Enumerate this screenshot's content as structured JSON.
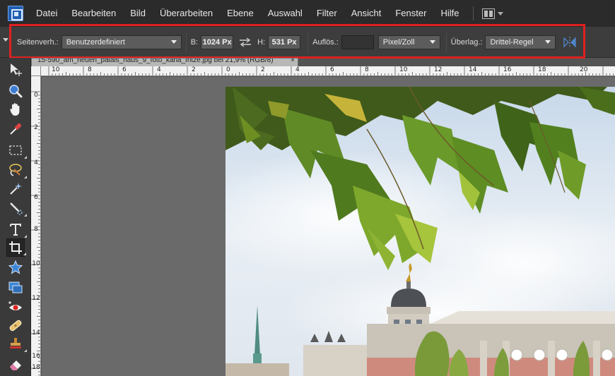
{
  "menubar": {
    "items": [
      "Datei",
      "Bearbeiten",
      "Bild",
      "Überarbeiten",
      "Ebene",
      "Auswahl",
      "Filter",
      "Ansicht",
      "Fenster",
      "Hilfe"
    ]
  },
  "options": {
    "aspect_label": "Seitenverh.:",
    "aspect_value": "Benutzerdefiniert",
    "width_label": "B:",
    "width_value": "1024 Px",
    "height_label": "H:",
    "height_value": "531 Px",
    "resolution_label": "Auflös.:",
    "resolution_value": "",
    "unit_value": "Pixel/Zoll",
    "overlay_label": "Überlag.:",
    "overlay_value": "Drittel-Regel"
  },
  "document": {
    "tab_title": "15-590_am_neuen_palais_haus_9_foto_karla_fritze.jpg bei 21,9% (RGB/8)",
    "close": "×"
  },
  "rulers": {
    "top_labels": [
      "10",
      "8",
      "6",
      "4",
      "2",
      "0",
      "2",
      "4",
      "6",
      "8",
      "10",
      "12",
      "14",
      "16",
      "18",
      "20"
    ],
    "left_labels": [
      "0",
      "2",
      "4",
      "6",
      "8",
      "10",
      "12",
      "14",
      "16",
      "18"
    ]
  },
  "colors": {
    "highlight": "#e02020",
    "menubar_bg": "#2b2b2b",
    "options_bg": "#3d3d3d",
    "canvas_bg": "#6a6a6a"
  },
  "tools": [
    "move-tool",
    "zoom-tool",
    "hand-tool",
    "eyedropper-tool",
    "marquee-tool",
    "lasso-tool",
    "magic-wand-tool",
    "quick-selection-tool",
    "type-tool",
    "crop-tool",
    "cookie-cutter-tool",
    "straighten-tool",
    "red-eye-tool",
    "healing-brush-tool",
    "clone-stamp-tool",
    "eraser-tool"
  ]
}
